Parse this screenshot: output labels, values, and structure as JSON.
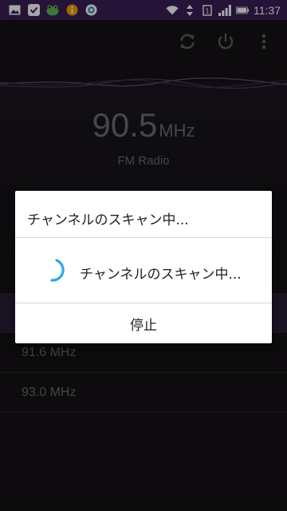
{
  "status_bar": {
    "time": "11:37",
    "left_icons": [
      "image-icon",
      "checkmark-icon",
      "frog-icon",
      "info-icon",
      "camera-icon"
    ],
    "right_icons": [
      "wifi-icon",
      "data-arrows-icon",
      "sim-icon",
      "signal-icon",
      "battery-icon"
    ]
  },
  "toolbar": {
    "icons": [
      "refresh-icon",
      "power-icon",
      "more-vert-icon"
    ]
  },
  "radio": {
    "frequency": "90.5",
    "unit": "MHz",
    "band_label": "FM Radio"
  },
  "stations": [
    {
      "label": "91.6 MHz"
    },
    {
      "label": "93.0 MHz"
    }
  ],
  "dialog": {
    "title": "チャンネルのスキャン中...",
    "message": "チャンネルのスキャン中...",
    "stop_label": "停止"
  },
  "colors": {
    "status_bar": "#3a1e56",
    "spinner": "#29a9e1",
    "accent_purple": "#2b1e3a"
  }
}
